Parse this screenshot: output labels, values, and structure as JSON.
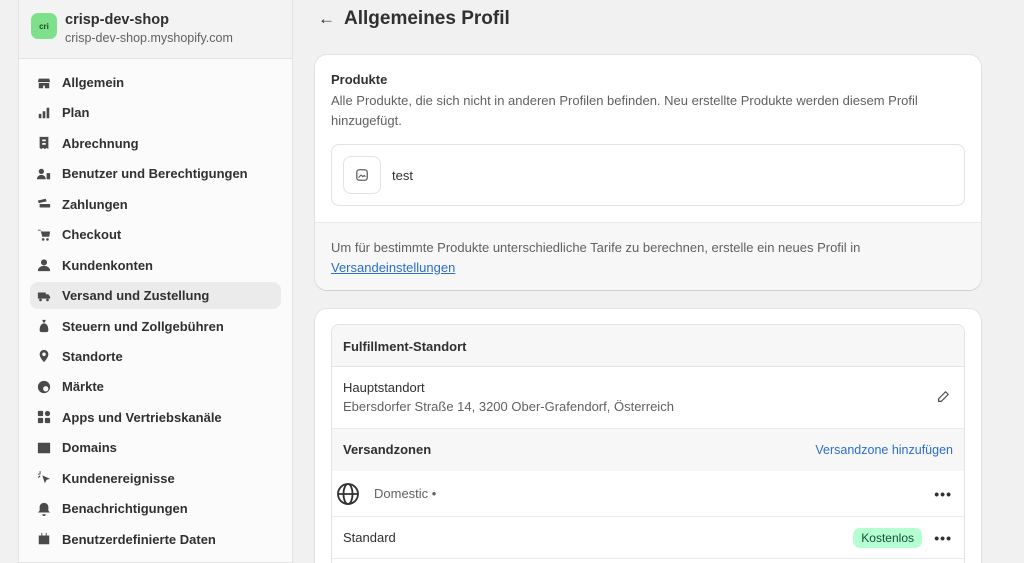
{
  "store": {
    "avatar_text": "cri",
    "name": "crisp-dev-shop",
    "domain": "crisp-dev-shop.myshopify.com"
  },
  "sidebar": {
    "items": [
      {
        "label": "Allgemein",
        "icon": "store-icon"
      },
      {
        "label": "Plan",
        "icon": "plan-icon"
      },
      {
        "label": "Abrechnung",
        "icon": "receipt-icon"
      },
      {
        "label": "Benutzer und Berechtigungen",
        "icon": "users-icon"
      },
      {
        "label": "Zahlungen",
        "icon": "payments-icon"
      },
      {
        "label": "Checkout",
        "icon": "cart-icon"
      },
      {
        "label": "Kundenkonten",
        "icon": "person-icon"
      },
      {
        "label": "Versand und Zustellung",
        "icon": "truck-icon",
        "active": true
      },
      {
        "label": "Steuern und Zollgebühren",
        "icon": "tax-icon"
      },
      {
        "label": "Standorte",
        "icon": "location-icon"
      },
      {
        "label": "Märkte",
        "icon": "globe-icon"
      },
      {
        "label": "Apps und Vertriebskanäle",
        "icon": "apps-icon"
      },
      {
        "label": "Domains",
        "icon": "domains-icon"
      },
      {
        "label": "Kundenereignisse",
        "icon": "cursor-icon"
      },
      {
        "label": "Benachrichtigungen",
        "icon": "bell-icon"
      },
      {
        "label": "Benutzerdefinierte Daten",
        "icon": "data-icon"
      }
    ]
  },
  "page": {
    "back_symbol": "←",
    "title": "Allgemeines Profil"
  },
  "products_card": {
    "title": "Produkte",
    "description": "Alle Produkte, die sich nicht in anderen Profilen befinden. Neu erstellte Produkte werden diesem Profil hinzugefügt.",
    "product_name": "test",
    "footer_text": "Um für bestimmte Produkte unterschiedliche Tarife zu berechnen, erstelle ein neues Profil in",
    "footer_link": "Versandeinstellungen"
  },
  "fulfillment_card": {
    "title": "Fulfillment-Standort",
    "location_name": "Hauptstandort",
    "location_address": "Ebersdorfer Straße 14, 3200 Ober-Grafendorf, Österreich",
    "zones_title": "Versandzonen",
    "add_zone_label": "Versandzone hinzufügen",
    "zone_name": "Domestic •",
    "more_symbol": "•••",
    "rate_name": "Standard",
    "rate_badge": "Kostenlos"
  },
  "colors": {
    "accent_link": "#2c6ecb",
    "avatar_bg": "#7ee08b",
    "badge_bg": "#b4fed2"
  }
}
